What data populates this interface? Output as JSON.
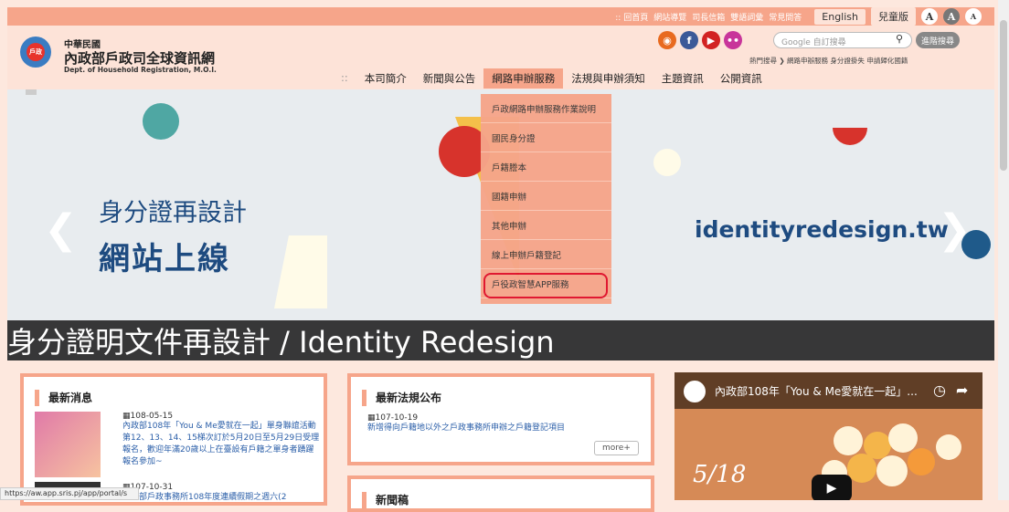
{
  "topbar": {
    "links": [
      "回首頁",
      "網站導覽",
      "司長信箱",
      "雙語詞彙",
      "常見問答"
    ],
    "english": "English",
    "kids": "兒童版",
    "font_large": "A",
    "font_medium": "A",
    "font_small": "A"
  },
  "brand": {
    "line1": "中華民國",
    "line2": "內政部戶政司全球資訊網",
    "line3": "Dept. of Household Registration, M.O.I.",
    "logo_text": "戶政"
  },
  "search": {
    "placeholder": "Google 自訂搜尋",
    "adv_button": "進階搜尋",
    "hot": "熱門搜尋 ❯ 網路申辦服務  身分證掛失  申請歸化國籍"
  },
  "nav": {
    "items": [
      "::",
      "本司簡介",
      "新聞與公告",
      "網路申辦服務",
      "法規與申辦須知",
      "主題資訊",
      "公開資訊"
    ]
  },
  "dropdown": {
    "items": [
      "戶政網路申辦服務作業說明",
      "國民身分證",
      "戶籍謄本",
      "國籍申辦",
      "其他申辦",
      "線上申辦戶籍登記",
      "戶役政智慧APP服務"
    ]
  },
  "slide": {
    "line1": "身分證再設計",
    "line2": "網站上線",
    "url": "identityredesign.tw",
    "caption": "身分證明文件再設計 / Identity Redesign"
  },
  "news": {
    "title": "最新消息",
    "items": [
      {
        "date": "108-05-15",
        "text": "內政部108年「You & Me愛就在一起」單身聯誼活動第12、13、14、15梯次訂於5月20日至5月29日受理報名，歡迎年滿20歲以上在臺設有戶籍之單身者踴躍報名參加~"
      },
      {
        "date": "107-10-31",
        "text": "內政部戶政事務所108年度連續假期之週六(2"
      }
    ]
  },
  "laws": {
    "title": "最新法規公布",
    "date": "107-10-19",
    "text": "新增得向戶籍地以外之戶政事務所申辦之戶籍登記項目",
    "more": "more+"
  },
  "news2": {
    "title": "新聞稿"
  },
  "video": {
    "title": "內政部108年「You & Me愛就在一起」..."
  },
  "status_url": "https://aw.app.sris.pj/app/portal/s",
  "colors": {
    "accent": "#f6a58a",
    "highlight": "#e0102a"
  }
}
